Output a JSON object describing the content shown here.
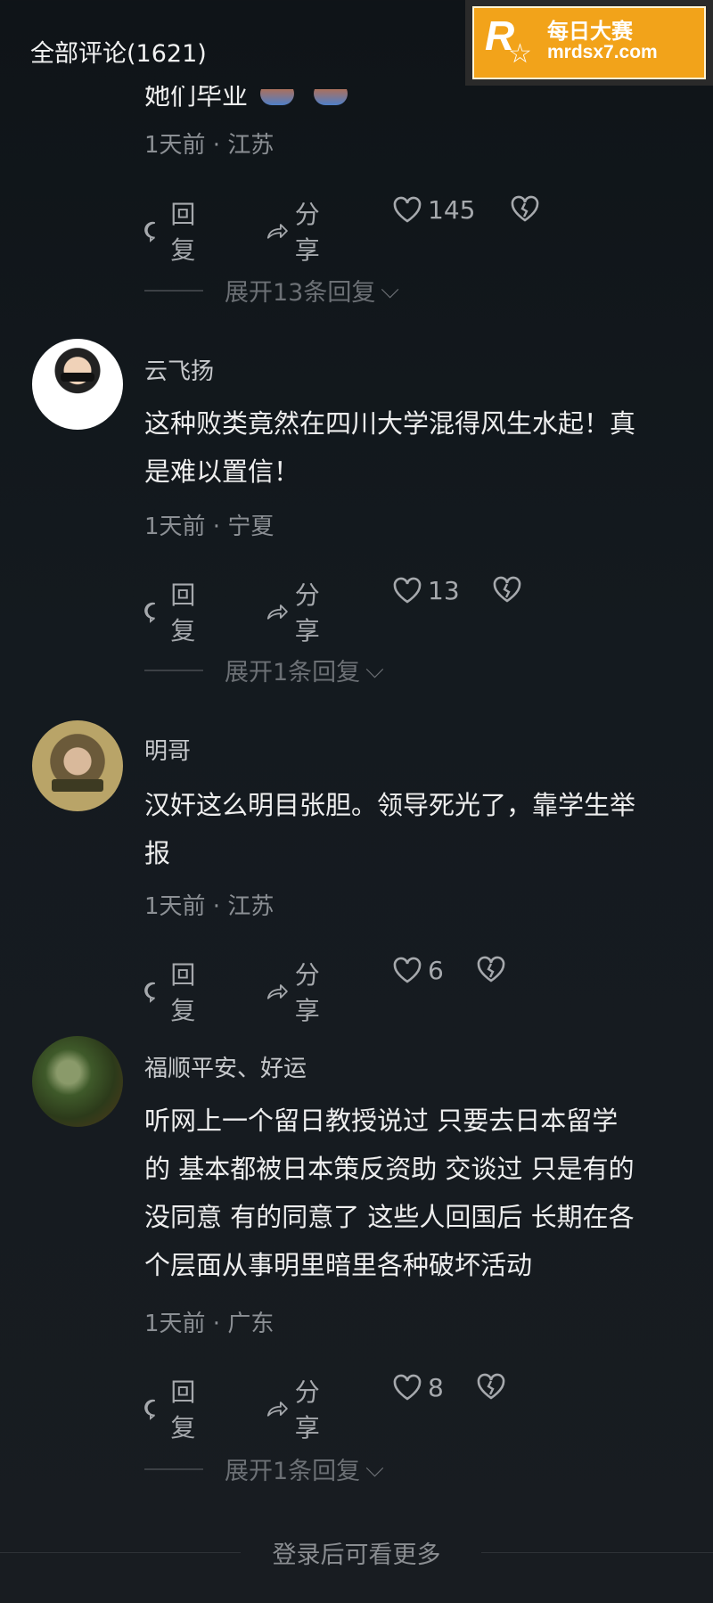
{
  "header": {
    "title": "全部评论(1621)"
  },
  "watermark": {
    "mark": "R",
    "line1": "每日大赛",
    "line2": "mrdsx7.com"
  },
  "top_comment": {
    "text_partial": "她们毕业",
    "meta": "1天前 · 江苏",
    "reply_label": "回复",
    "share_label": "分享",
    "likes": "145",
    "expand_label": "展开13条回复"
  },
  "comments": [
    {
      "username": "云飞扬",
      "text_lines": [
        "这种败类竟然在四川大学混得风生水起！真",
        "是难以置信！"
      ],
      "meta": "1天前 · 宁夏",
      "reply_label": "回复",
      "share_label": "分享",
      "likes": "13",
      "expand_label": "展开1条回复"
    },
    {
      "username": "明哥",
      "text_lines": [
        "汉奸这么明目张胆。领导死光了，靠学生举",
        "报"
      ],
      "meta": "1天前 · 江苏",
      "reply_label": "回复",
      "share_label": "分享",
      "likes": "6"
    },
    {
      "username": "福顺平安、好运",
      "text_lines": [
        "听网上一个留日教授说过  只要去日本留学",
        "的 基本都被日本策反资助 交谈过 只是有的",
        "没同意 有的同意了  这些人回国后 长期在各",
        "个层面从事明里暗里各种破坏活动"
      ],
      "meta": "1天前 · 广东",
      "reply_label": "回复",
      "share_label": "分享",
      "likes": "8",
      "expand_label": "展开1条回复"
    }
  ],
  "footer": {
    "more_label": "登录后可看更多"
  },
  "colors": {
    "background": "#141a1f",
    "accent_logo": "#f2a31a"
  }
}
